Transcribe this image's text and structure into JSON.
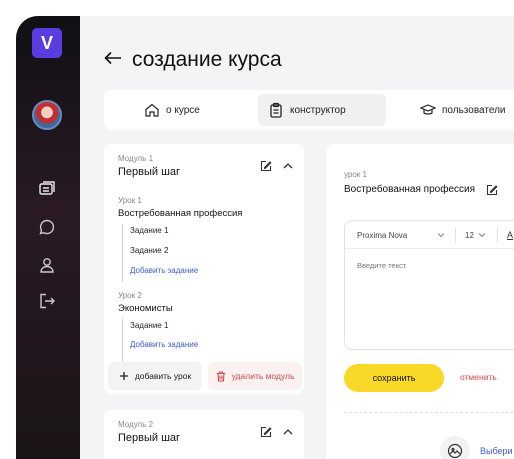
{
  "app": {
    "logo_letter": "V",
    "accent": "#5a3de0"
  },
  "page": {
    "title": "создание курса"
  },
  "tabs": [
    {
      "label": "о курсе",
      "icon": "home-icon",
      "active": false
    },
    {
      "label": "конструктор",
      "icon": "clipboard-icon",
      "active": true
    },
    {
      "label": "пользователи",
      "icon": "graduation-cap-icon",
      "active": false
    }
  ],
  "modules": [
    {
      "label": "Модуль 1",
      "title": "Первый шаг",
      "lessons": [
        {
          "label": "Урок 1",
          "title": "Востребованная профессия",
          "tasks": [
            "Задание 1",
            "Задание 2"
          ],
          "add_task": "Добавить задание"
        },
        {
          "label": "Урок 2",
          "title": "Экономисты",
          "tasks": [
            "Задание 1"
          ],
          "add_task": "Добавить задание"
        }
      ],
      "add_lesson": "добавить урок",
      "delete_module": "удалить модуль"
    },
    {
      "label": "Модуль 2",
      "title": "Первый шаг"
    }
  ],
  "lesson_editor": {
    "label": "урок 1",
    "title": "Востребованная профессия",
    "font": "Proxima Nova",
    "font_size": "12",
    "format_glyph": "A",
    "placeholder": "Введите текст",
    "save": "сохранить",
    "cancel": "отменить",
    "choose": "Выбери"
  },
  "colors": {
    "save": "#f9d928",
    "cancel": "#e04848",
    "link": "#3b5ccc"
  }
}
